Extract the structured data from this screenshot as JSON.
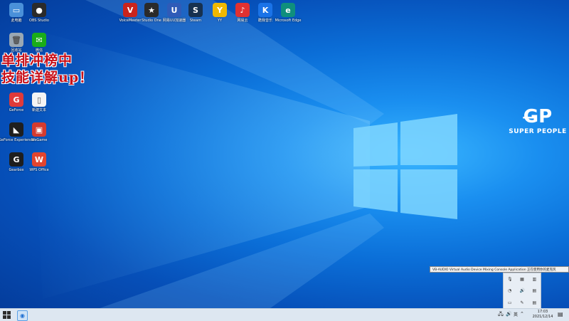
{
  "desktop_icons": [
    {
      "label": "此电脑",
      "color": "#4a90d9",
      "glyph": "▭",
      "icon": "computer-icon"
    },
    {
      "label": "OBS Studio",
      "color": "#2b2b2b",
      "glyph": "●",
      "icon": "obs-icon"
    },
    {
      "label": "回收站",
      "color": "#9aa7b3",
      "glyph": "🗑",
      "icon": "recycle-bin-icon"
    },
    {
      "label": "微信",
      "color": "#1aad19",
      "glyph": "✉",
      "icon": "wechat-icon"
    },
    {
      "label": "GeForce",
      "color": "#e03a3a",
      "glyph": "G",
      "icon": "geforce-icon"
    },
    {
      "label": "新建文本",
      "color": "#f4f4f4",
      "glyph": "▯",
      "icon": "text-file-icon"
    },
    {
      "label": "GeForce Experience",
      "color": "#1f1f1f",
      "glyph": "◣",
      "icon": "nvidia-icon"
    },
    {
      "label": "WeGame",
      "color": "#d43b2f",
      "glyph": "▣",
      "icon": "game-icon"
    },
    {
      "label": "Gearbox",
      "color": "#1e1e1e",
      "glyph": "G",
      "icon": "gear-app-icon"
    },
    {
      "label": "WPS Office",
      "color": "#e2452f",
      "glyph": "W",
      "icon": "wps-icon"
    },
    {
      "label": "VoiceMeeter",
      "color": "#c9241d",
      "glyph": "V",
      "icon": "voice-icon"
    },
    {
      "label": "Studio One",
      "color": "#2a2a2a",
      "glyph": "★",
      "icon": "studio-icon"
    },
    {
      "label": "网易UU加速器",
      "color": "#2f5bb8",
      "glyph": "U",
      "icon": "uu-icon"
    },
    {
      "label": "Steam",
      "color": "#17314f",
      "glyph": "S",
      "icon": "steam-icon"
    },
    {
      "label": "YY",
      "color": "#f0b800",
      "glyph": "Y",
      "icon": "yy-icon"
    },
    {
      "label": "网易云",
      "color": "#e23131",
      "glyph": "♪",
      "icon": "music-icon"
    },
    {
      "label": "酷我音乐",
      "color": "#1a73e8",
      "glyph": "K",
      "icon": "kuwo-icon"
    },
    {
      "label": "Microsoft Edge",
      "color": "#0f8f7d",
      "glyph": "e",
      "icon": "edge-icon"
    }
  ],
  "overlay": {
    "line1": "单排冲榜中",
    "line2": "技能详解up！"
  },
  "brand": {
    "mark": "G̶P",
    "name": "SUPER PEOPLE",
    "color": "#ffffff"
  },
  "tooltip": "VB-AUDIO Virtual Audio Device Mixing Console Application 正在使用你的麦克风",
  "tray_popup_icons": [
    "🎙",
    "▦",
    "▥",
    "◔",
    "🔊",
    "▤",
    "▭",
    "✎",
    "▤"
  ],
  "taskbar": {
    "tray_items": [
      "⌃",
      "🖧",
      "🔊",
      "英"
    ],
    "time": "17:03",
    "date": "2021/12/14",
    "notification_icon": "▤"
  },
  "colors": {
    "overlay_red": "#c8101a",
    "taskbar_bg": "#dde7f1"
  }
}
